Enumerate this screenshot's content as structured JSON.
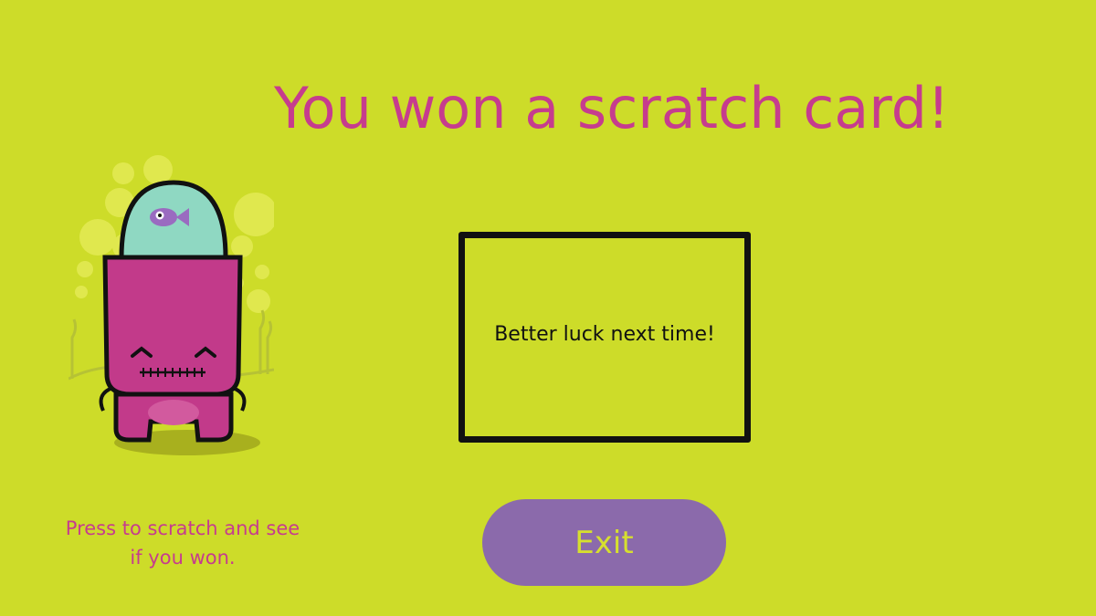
{
  "title": "You won a scratch card!",
  "scratch_card": {
    "message": "Better luck next time!"
  },
  "hint": {
    "line1": "Press to scratch and see",
    "line2": "if you won."
  },
  "exit_button": {
    "label": "Exit"
  },
  "colors": {
    "background": "#cddc29",
    "accent_pink": "#c63c8e",
    "button_purple": "#8b6aab",
    "button_text": "#d6df2f",
    "card_border": "#111111"
  },
  "character": {
    "icon": "pink-monster-with-fish-bowl-helmet"
  }
}
